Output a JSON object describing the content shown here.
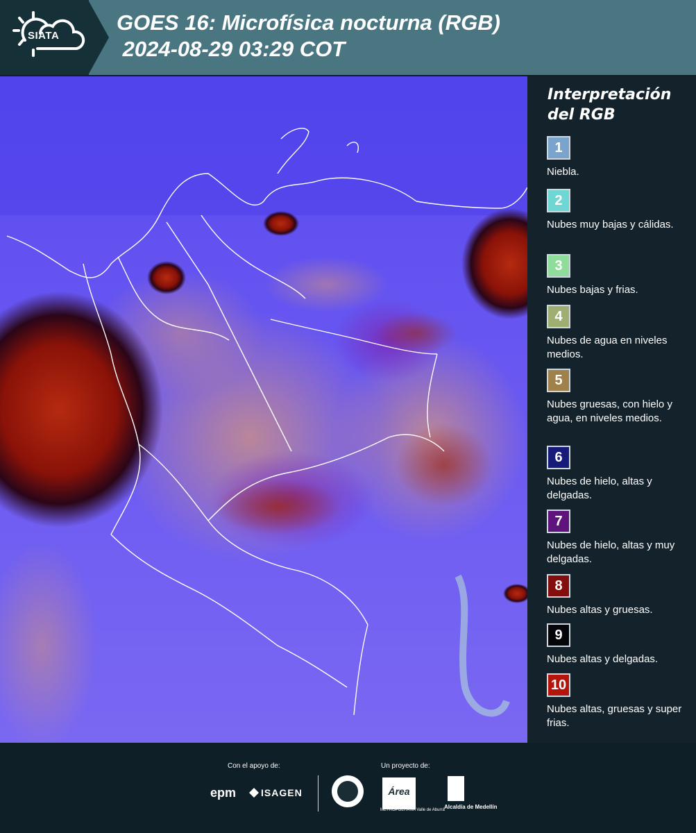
{
  "header": {
    "logo_text": "SIATA",
    "title_line1": "GOES 16: Microfísica nocturna (RGB)",
    "title_line2": " 2024-08-29 03:29 COT"
  },
  "legend": {
    "title": "Interpretación del RGB",
    "items": [
      {
        "num": "1",
        "color": "#7aa4cc",
        "desc": "Niebla."
      },
      {
        "num": "2",
        "color": "#6fd7d3",
        "desc": "Nubes muy bajas y cálidas."
      },
      {
        "num": "3",
        "color": "#8fdc9b",
        "desc": "Nubes bajas y frias."
      },
      {
        "num": "4",
        "color": "#9fae71",
        "desc": "Nubes de agua en niveles medios."
      },
      {
        "num": "5",
        "color": "#a0804b",
        "desc": "Nubes gruesas, con hielo y agua, en niveles medios."
      },
      {
        "num": "6",
        "color": "#161a78",
        "desc": "Nubes de hielo, altas y delgadas."
      },
      {
        "num": "7",
        "color": "#5f137c",
        "desc": "Nubes de hielo, altas y muy delgadas."
      },
      {
        "num": "8",
        "color": "#840d0e",
        "desc": "Nubes altas y gruesas."
      },
      {
        "num": "9",
        "color": "#05050a",
        "desc": "Nubes altas y delgadas."
      },
      {
        "num": "10",
        "color": "#b5140a",
        "desc": "Nubes altas, gruesas y super frias."
      }
    ]
  },
  "footer": {
    "support_label": "Con el apoyo de:",
    "project_label": "Un proyecto de:",
    "sponsor1": "epm",
    "sponsor2": "ISAGEN",
    "partner1": "Área",
    "partner1_sub": "METROPOLITANA Valle de Aburrá",
    "partner2": "Alcaldía de Medellín"
  },
  "icons": [
    "sun-cloud-logo-icon",
    "isagen-icon",
    "seal-icon",
    "alcaldia-shield-icon"
  ]
}
